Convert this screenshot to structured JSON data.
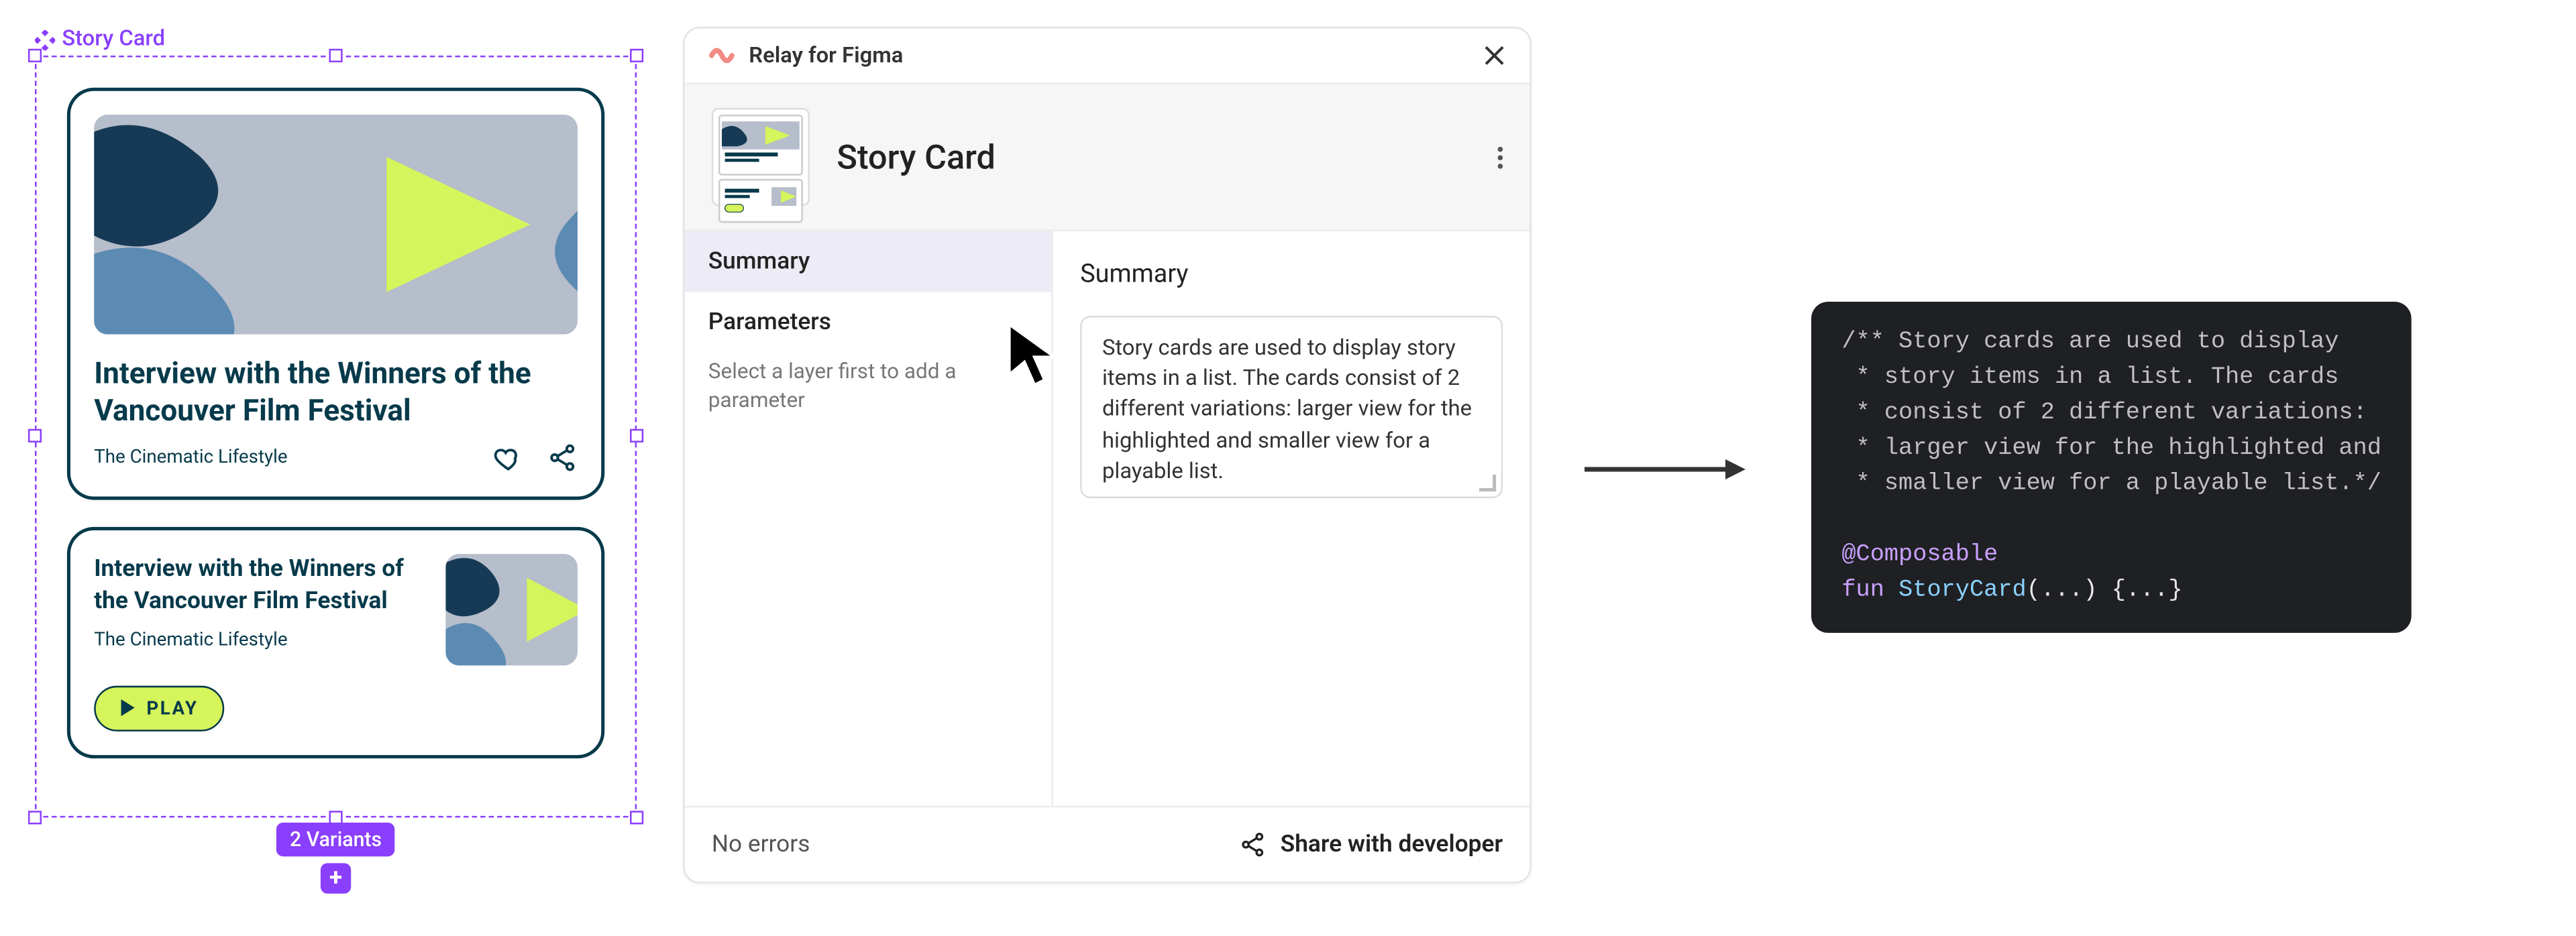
{
  "figma": {
    "component_label": "Story Card",
    "variants_badge": "2 Variants",
    "card_large": {
      "title": "Interview with the Winners of the Vancouver Film Festival",
      "subtitle": "The Cinematic Lifestyle"
    },
    "card_small": {
      "title": "Interview with the Winners of the Vancouver Film Festival",
      "subtitle": "The Cinematic Lifestyle",
      "play_label": "PLAY"
    }
  },
  "relay": {
    "brand": "Relay for Figma",
    "title": "Story Card",
    "sidebar": {
      "summary_label": "Summary",
      "parameters_label": "Parameters",
      "hint": "Select a layer first to add a parameter"
    },
    "main": {
      "heading": "Summary",
      "summary_text": "Story cards are used to display story items in a list. The cards consist of 2 different variations: larger view for the highlighted and smaller view for a playable list."
    },
    "footer": {
      "status": "No errors",
      "share_label": "Share with developer"
    }
  },
  "code": {
    "comment1": "/** Story cards are used to display",
    "comment2": " * story items in a list. The cards",
    "comment3": " * consist of 2 different variations:",
    "comment4": " * larger view for the highlighted and",
    "comment5": " * smaller view for a playable list.*/",
    "annotation": "@Composable",
    "fun_kw": "fun",
    "fun_name": "StoryCard",
    "fun_sig": "(...) {...}"
  }
}
